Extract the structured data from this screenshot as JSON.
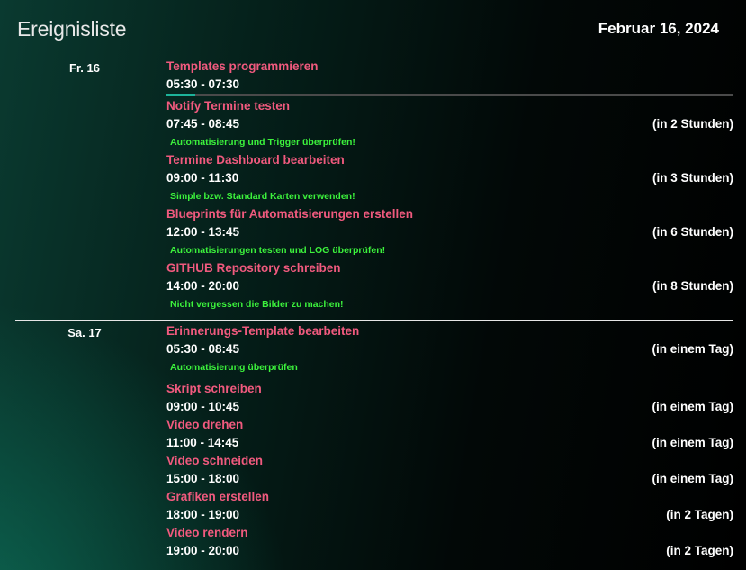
{
  "header": {
    "title": "Ereignisliste",
    "date": "Februar 16, 2024"
  },
  "colors": {
    "event_title": "#f05a7e",
    "description": "#3cf23c",
    "progress_fill": "#1db39a",
    "progress_track": "#4a4a4a"
  },
  "days": [
    {
      "label": "Fr. 16",
      "events": [
        {
          "title": "Templates programmieren",
          "time": "05:30 - 07:30",
          "relative": "",
          "description": "",
          "progress": 0.05
        },
        {
          "title": "Notify Termine testen",
          "time": "07:45 - 08:45",
          "relative": "(in 2 Stunden)",
          "description": "Automatisierung und Trigger überprüfen!"
        },
        {
          "title": "Termine Dashboard bearbeiten",
          "time": "09:00 - 11:30",
          "relative": "(in 3 Stunden)",
          "description": "Simple bzw. Standard Karten verwenden!"
        },
        {
          "title": "Blueprints für Automatisierungen erstellen",
          "time": "12:00 - 13:45",
          "relative": "(in 6 Stunden)",
          "description": "Automatisierungen testen und LOG überprüfen!"
        },
        {
          "title": "GITHUB Repository schreiben",
          "time": "14:00 - 20:00",
          "relative": "(in 8 Stunden)",
          "description": "Nicht vergessen die Bilder zu machen!"
        }
      ]
    },
    {
      "label": "Sa. 17",
      "events": [
        {
          "title": "Erinnerungs-Template bearbeiten",
          "time": "05:30 - 08:45",
          "relative": "(in einem Tag)",
          "description": "Automatisierung überprüfen"
        },
        {
          "title": "Skript schreiben",
          "time": "09:00 - 10:45",
          "relative": "(in einem Tag)",
          "description": ""
        },
        {
          "title": "Video drehen",
          "time": "11:00 - 14:45",
          "relative": "(in einem Tag)",
          "description": ""
        },
        {
          "title": "Video schneiden",
          "time": "15:00 - 18:00",
          "relative": "(in einem Tag)",
          "description": ""
        },
        {
          "title": "Grafiken erstellen",
          "time": "18:00 - 19:00",
          "relative": "(in 2 Tagen)",
          "description": ""
        },
        {
          "title": "Video rendern",
          "time": "19:00 - 20:00",
          "relative": "(in 2 Tagen)",
          "description": ""
        }
      ]
    }
  ]
}
